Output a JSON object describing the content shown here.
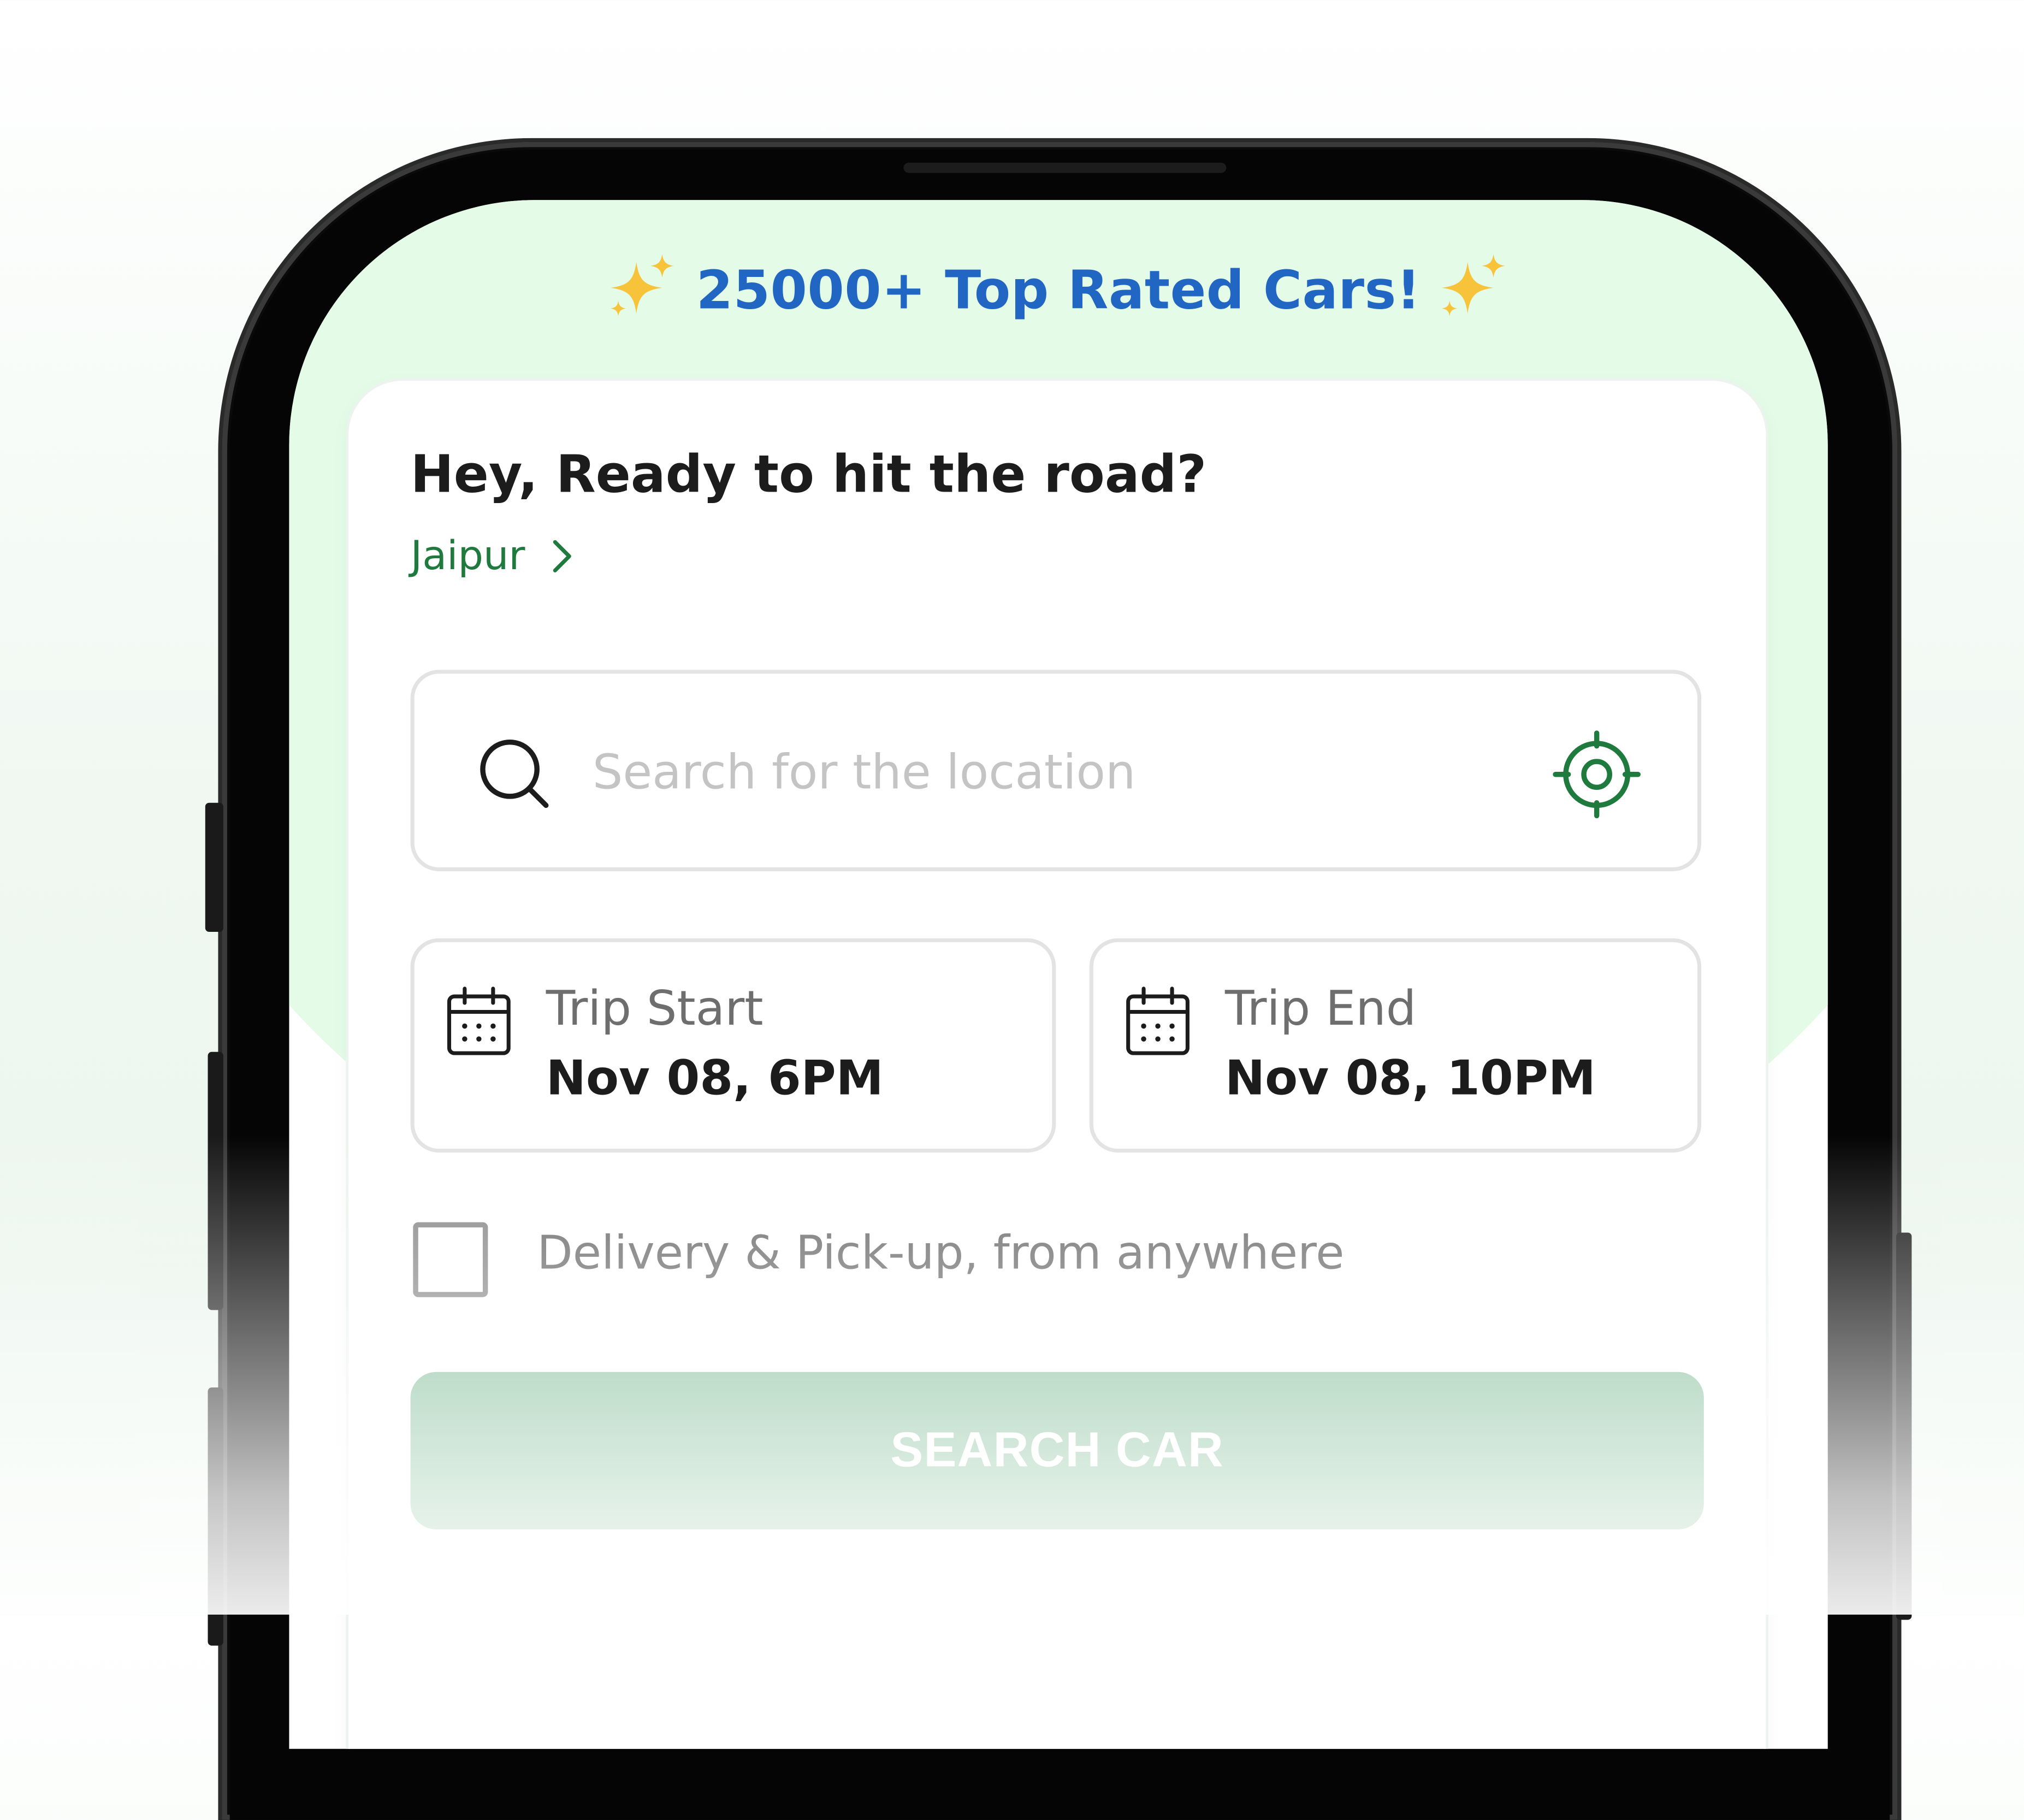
{
  "banner": {
    "text": "25000+ Top Rated Cars!",
    "left_icon": "sparkles-icon",
    "right_icon": "sparkles-icon"
  },
  "card": {
    "greeting": "Hey, Ready to hit the road?",
    "city": "Jaipur",
    "city_icon": "chevron-right-icon"
  },
  "search": {
    "placeholder": "Search for the location",
    "value": "",
    "left_icon": "search-icon",
    "right_icon": "locate-icon"
  },
  "trip": {
    "start": {
      "label": "Trip Start",
      "value": "Nov 08, 6PM",
      "icon": "calendar-icon"
    },
    "end": {
      "label": "Trip End",
      "value": "Nov 08, 10PM",
      "icon": "calendar-icon"
    }
  },
  "delivery": {
    "label": "Delivery & Pick-up, from anywhere",
    "checked": false
  },
  "cta": {
    "label": "SEARCH CAR"
  },
  "colors": {
    "brand_green": "#1f7a3d",
    "banner_blue": "#2166c2",
    "button_green": "#7fbc95",
    "screen_tint": "#e4fbe7",
    "sparkle_yellow": "#f6c33a"
  }
}
